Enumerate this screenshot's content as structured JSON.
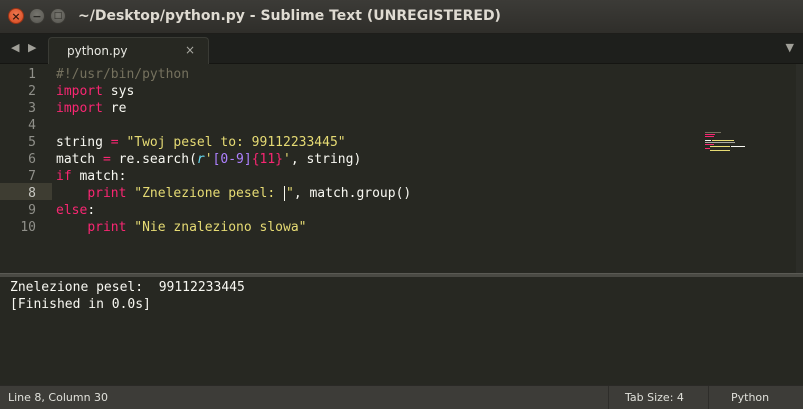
{
  "window": {
    "title": "~/Desktop/python.py - Sublime Text (UNREGISTERED)",
    "close_glyph": "×",
    "minimize_glyph": "−",
    "maximize_glyph": "□"
  },
  "tabbar": {
    "nav_left": "◀",
    "nav_right": "▶",
    "tab_label": "python.py",
    "tab_close": "×",
    "dropdown": "▼"
  },
  "editor": {
    "current_line": 8,
    "line_numbers": [
      "1",
      "2",
      "3",
      "4",
      "5",
      "6",
      "7",
      "8",
      "9",
      "10"
    ],
    "lines": [
      [
        {
          "t": "#!/usr/bin/python",
          "c": "comment"
        }
      ],
      [
        {
          "t": "import",
          "c": "kw"
        },
        {
          "t": " sys",
          "c": "pl"
        }
      ],
      [
        {
          "t": "import",
          "c": "kw"
        },
        {
          "t": " re",
          "c": "pl"
        }
      ],
      [],
      [
        {
          "t": "string ",
          "c": "pl"
        },
        {
          "t": "=",
          "c": "kw"
        },
        {
          "t": " ",
          "c": "pl"
        },
        {
          "t": "\"Twoj pesel to: 99112233445\"",
          "c": "str"
        }
      ],
      [
        {
          "t": "match ",
          "c": "pl"
        },
        {
          "t": "=",
          "c": "kw"
        },
        {
          "t": " re.search(",
          "c": "pl"
        },
        {
          "t": "r",
          "c": "fn"
        },
        {
          "t": "'",
          "c": "str"
        },
        {
          "t": "[0-9]",
          "c": "num"
        },
        {
          "t": "{11}",
          "c": "kw"
        },
        {
          "t": "'",
          "c": "str"
        },
        {
          "t": ", string)",
          "c": "pl"
        }
      ],
      [
        {
          "t": "if",
          "c": "kw"
        },
        {
          "t": " match:",
          "c": "pl"
        }
      ],
      [
        {
          "t": "    ",
          "c": "pl"
        },
        {
          "t": "print",
          "c": "kw"
        },
        {
          "t": " ",
          "c": "pl"
        },
        {
          "t": "\"Znelezione pesel: ",
          "c": "str"
        },
        {
          "t": "|",
          "c": "caret"
        },
        {
          "t": "\"",
          "c": "str"
        },
        {
          "t": ", match.group()",
          "c": "pl"
        }
      ],
      [
        {
          "t": "else",
          "c": "kw"
        },
        {
          "t": ":",
          "c": "pl"
        }
      ],
      [
        {
          "t": "    ",
          "c": "pl"
        },
        {
          "t": "print",
          "c": "kw"
        },
        {
          "t": " ",
          "c": "pl"
        },
        {
          "t": "\"Nie znaleziono slowa\"",
          "c": "str"
        }
      ]
    ]
  },
  "output": {
    "lines": [
      "Znelezione pesel:  99112233445",
      "[Finished in 0.0s]"
    ]
  },
  "statusbar": {
    "position": "Line 8, Column 30",
    "tab_size": "Tab Size: 4",
    "syntax": "Python"
  },
  "colors": {
    "background": "#272822",
    "keyword": "#f92672",
    "string": "#e6db74",
    "comment": "#75715e",
    "number": "#ae81ff",
    "function": "#66d9ef"
  }
}
